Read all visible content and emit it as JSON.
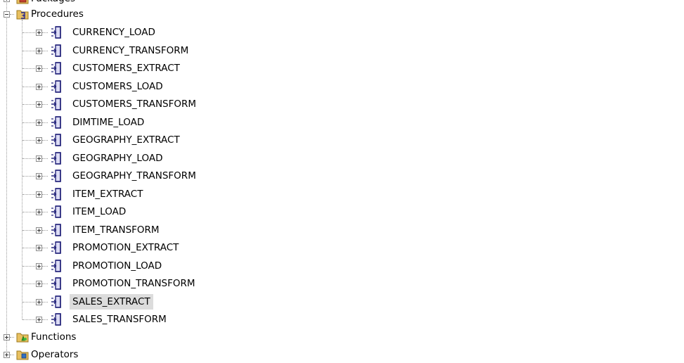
{
  "tree": {
    "packages_label": "Packages",
    "procedures_label": "Procedures",
    "functions_label": "Functions",
    "operators_label": "Operators",
    "procedures": [
      {
        "label": "CURRENCY_LOAD"
      },
      {
        "label": "CURRENCY_TRANSFORM"
      },
      {
        "label": "CUSTOMERS_EXTRACT"
      },
      {
        "label": "CUSTOMERS_LOAD"
      },
      {
        "label": "CUSTOMERS_TRANSFORM"
      },
      {
        "label": "DIMTIME_LOAD"
      },
      {
        "label": "GEOGRAPHY_EXTRACT"
      },
      {
        "label": "GEOGRAPHY_LOAD"
      },
      {
        "label": "GEOGRAPHY_TRANSFORM"
      },
      {
        "label": "ITEM_EXTRACT"
      },
      {
        "label": "ITEM_LOAD"
      },
      {
        "label": "ITEM_TRANSFORM"
      },
      {
        "label": "PROMOTION_EXTRACT"
      },
      {
        "label": "PROMOTION_LOAD"
      },
      {
        "label": "PROMOTION_TRANSFORM"
      },
      {
        "label": "SALES_EXTRACT",
        "selected": true
      },
      {
        "label": "SALES_TRANSFORM"
      }
    ]
  }
}
